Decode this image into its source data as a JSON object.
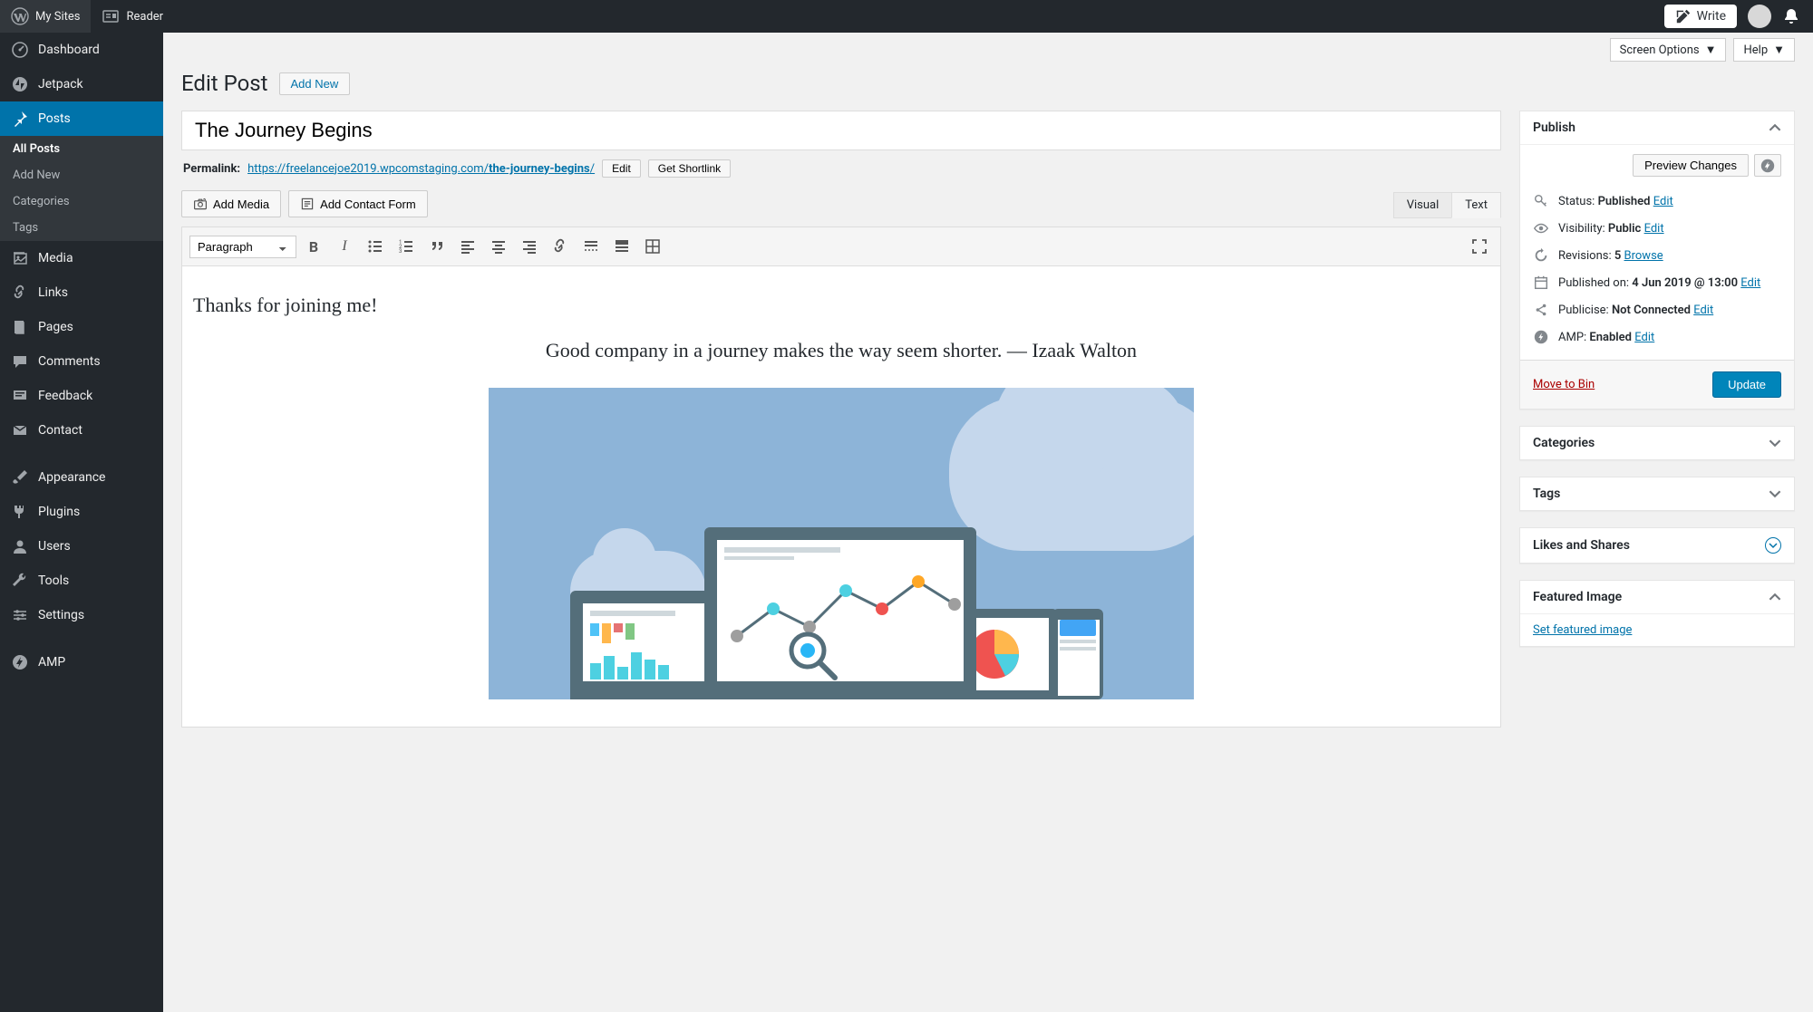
{
  "topbar": {
    "mysites": "My Sites",
    "reader": "Reader",
    "write": "Write"
  },
  "sidebar": {
    "dashboard": "Dashboard",
    "jetpack": "Jetpack",
    "posts": "Posts",
    "submenu": {
      "all_posts": "All Posts",
      "add_new": "Add New",
      "categories": "Categories",
      "tags": "Tags"
    },
    "media": "Media",
    "links": "Links",
    "pages": "Pages",
    "comments": "Comments",
    "feedback": "Feedback",
    "contact": "Contact",
    "appearance": "Appearance",
    "plugins": "Plugins",
    "users": "Users",
    "tools": "Tools",
    "settings": "Settings",
    "amp": "AMP"
  },
  "top_actions": {
    "screen_options": "Screen Options",
    "help": "Help"
  },
  "page": {
    "title": "Edit Post",
    "add_new": "Add New"
  },
  "post": {
    "title": "The Journey Begins",
    "permalink_label": "Permalink:",
    "permalink_base": "https://freelancejoe2019.wpcomstaging.com/",
    "slug": "the-journey-begins",
    "trail": "/",
    "edit": "Edit",
    "shortlink": "Get Shortlink"
  },
  "media_buttons": {
    "add_media": "Add Media",
    "add_contact_form": "Add Contact Form"
  },
  "tabs": {
    "visual": "Visual",
    "text": "Text"
  },
  "toolbar": {
    "format": "Paragraph"
  },
  "content": {
    "intro": "Thanks for joining me!",
    "quote": "Good company in a journey makes the way seem shorter. — Izaak Walton"
  },
  "publish": {
    "title": "Publish",
    "preview": "Preview Changes",
    "status_label": "Status:",
    "status_value": "Published",
    "visibility_label": "Visibility:",
    "visibility_value": "Public",
    "revisions_label": "Revisions:",
    "revisions_value": "5",
    "browse": "Browse",
    "published_label": "Published on:",
    "published_value": "4 Jun 2019 @ 13:00",
    "publicise_label": "Publicise:",
    "publicise_value": "Not Connected",
    "amp_label": "AMP:",
    "amp_value": "Enabled",
    "edit": "Edit",
    "bin": "Move to Bin",
    "update": "Update"
  },
  "panels": {
    "categories": "Categories",
    "tags": "Tags",
    "likes": "Likes and Shares",
    "featured": "Featured Image",
    "set_featured": "Set featured image"
  }
}
